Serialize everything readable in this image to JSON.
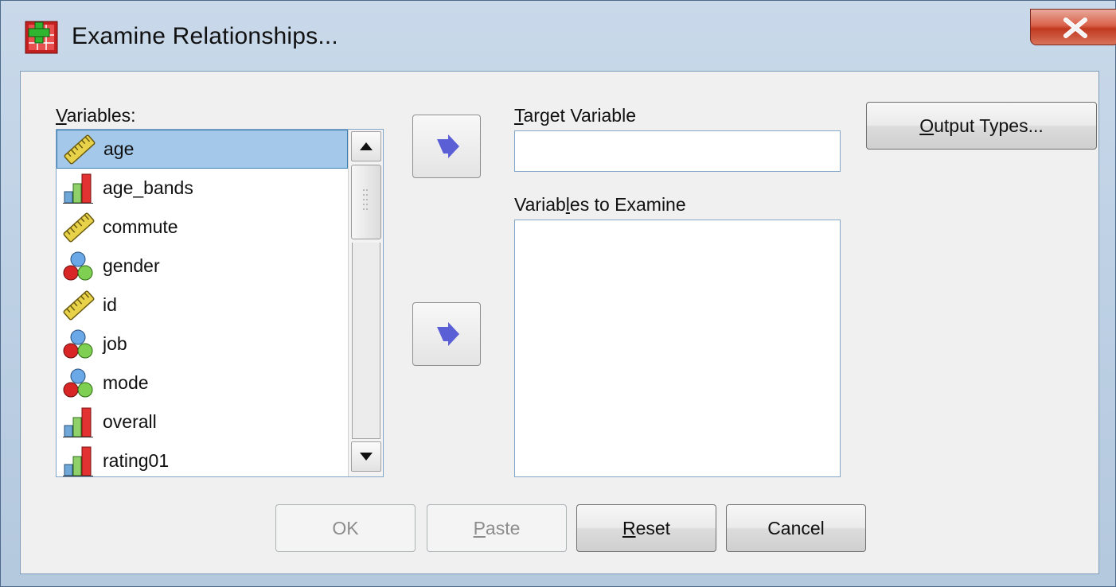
{
  "window": {
    "title": "Examine Relationships..."
  },
  "labels": {
    "variables_prefix": "V",
    "variables_rest": "ariables:",
    "target_prefix": "T",
    "target_rest": "arget Variable",
    "examine_before": "Variab",
    "examine_underlined": "l",
    "examine_after": "es to Examine"
  },
  "variables": [
    {
      "name": "age",
      "type": "scale-icon",
      "selected": true
    },
    {
      "name": "age_bands",
      "type": "ordinal-icon",
      "selected": false
    },
    {
      "name": "commute",
      "type": "scale-icon",
      "selected": false
    },
    {
      "name": "gender",
      "type": "nominal-icon",
      "selected": false
    },
    {
      "name": "id",
      "type": "scale-icon",
      "selected": false
    },
    {
      "name": "job",
      "type": "nominal-icon",
      "selected": false
    },
    {
      "name": "mode",
      "type": "nominal-icon",
      "selected": false
    },
    {
      "name": "overall",
      "type": "ordinal-icon",
      "selected": false
    },
    {
      "name": "rating01",
      "type": "ordinal-icon",
      "selected": false
    }
  ],
  "target_variable": {
    "value": ""
  },
  "buttons": {
    "output_types_prefix": "O",
    "output_types_rest": "utput Types...",
    "ok": "OK",
    "paste_prefix": "P",
    "paste_rest": "aste",
    "reset_prefix": "R",
    "reset_rest": "eset",
    "cancel": "Cancel"
  },
  "colors": {
    "selection": "#a4c8ea",
    "arrow": "#5b5fd6",
    "close_button": "#c0391f"
  }
}
